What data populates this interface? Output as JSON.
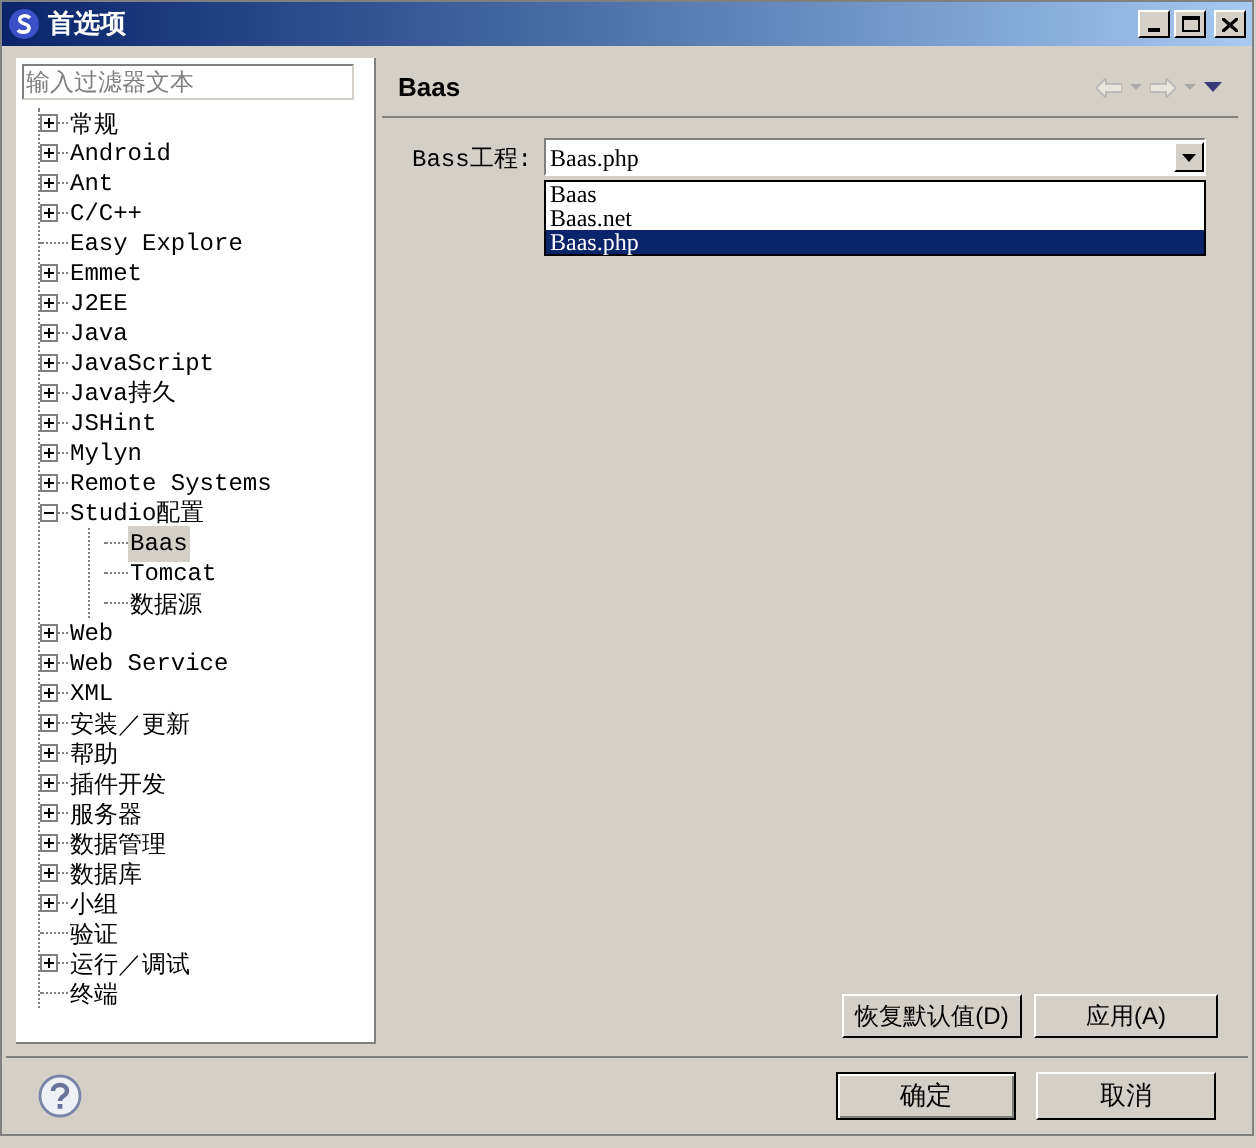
{
  "window": {
    "title": "首选项"
  },
  "filter": {
    "placeholder": "输入过滤器文本"
  },
  "tree": [
    {
      "label": "常规",
      "kind": "group",
      "expanded": false,
      "selected": false
    },
    {
      "label": "Android",
      "kind": "group",
      "expanded": false,
      "selected": false
    },
    {
      "label": "Ant",
      "kind": "group",
      "expanded": false,
      "selected": false
    },
    {
      "label": "C/C++",
      "kind": "group",
      "expanded": false,
      "selected": false
    },
    {
      "label": "Easy Explore",
      "kind": "leaf",
      "selected": false
    },
    {
      "label": "Emmet",
      "kind": "group",
      "expanded": false,
      "selected": false
    },
    {
      "label": "J2EE",
      "kind": "group",
      "expanded": false,
      "selected": false
    },
    {
      "label": "Java",
      "kind": "group",
      "expanded": false,
      "selected": false
    },
    {
      "label": "JavaScript",
      "kind": "group",
      "expanded": false,
      "selected": false
    },
    {
      "label": "Java持久",
      "kind": "group",
      "expanded": false,
      "selected": false
    },
    {
      "label": "JSHint",
      "kind": "group",
      "expanded": false,
      "selected": false
    },
    {
      "label": "Mylyn",
      "kind": "group",
      "expanded": false,
      "selected": false
    },
    {
      "label": "Remote Systems",
      "kind": "group",
      "expanded": false,
      "selected": false
    },
    {
      "label": "Studio配置",
      "kind": "group",
      "expanded": true,
      "selected": false,
      "children": [
        {
          "label": "Baas",
          "kind": "leaf",
          "selected": true
        },
        {
          "label": "Tomcat",
          "kind": "leaf",
          "selected": false
        },
        {
          "label": "数据源",
          "kind": "leaf",
          "selected": false
        }
      ]
    },
    {
      "label": "Web",
      "kind": "group",
      "expanded": false,
      "selected": false
    },
    {
      "label": "Web Service",
      "kind": "group",
      "expanded": false,
      "selected": false
    },
    {
      "label": "XML",
      "kind": "group",
      "expanded": false,
      "selected": false
    },
    {
      "label": "安装／更新",
      "kind": "group",
      "expanded": false,
      "selected": false
    },
    {
      "label": "帮助",
      "kind": "group",
      "expanded": false,
      "selected": false
    },
    {
      "label": "插件开发",
      "kind": "group",
      "expanded": false,
      "selected": false
    },
    {
      "label": "服务器",
      "kind": "group",
      "expanded": false,
      "selected": false
    },
    {
      "label": "数据管理",
      "kind": "group",
      "expanded": false,
      "selected": false
    },
    {
      "label": "数据库",
      "kind": "group",
      "expanded": false,
      "selected": false
    },
    {
      "label": "小组",
      "kind": "group",
      "expanded": false,
      "selected": false
    },
    {
      "label": "验证",
      "kind": "leaf",
      "selected": false
    },
    {
      "label": "运行／调试",
      "kind": "group",
      "expanded": false,
      "selected": false
    },
    {
      "label": "终端",
      "kind": "leaf",
      "selected": false
    }
  ],
  "page": {
    "title": "Baas",
    "field_label": "Bass工程:",
    "combo_value": "Baas.php",
    "options": [
      {
        "label": "Baas",
        "selected": false
      },
      {
        "label": "Baas.net",
        "selected": false
      },
      {
        "label": "Baas.php",
        "selected": true
      }
    ]
  },
  "page_buttons": [
    "恢复默认值(D)",
    "应用(A)"
  ],
  "dialog_buttons": [
    {
      "label": "确定",
      "default": true
    },
    {
      "label": "取消",
      "default": false
    }
  ]
}
